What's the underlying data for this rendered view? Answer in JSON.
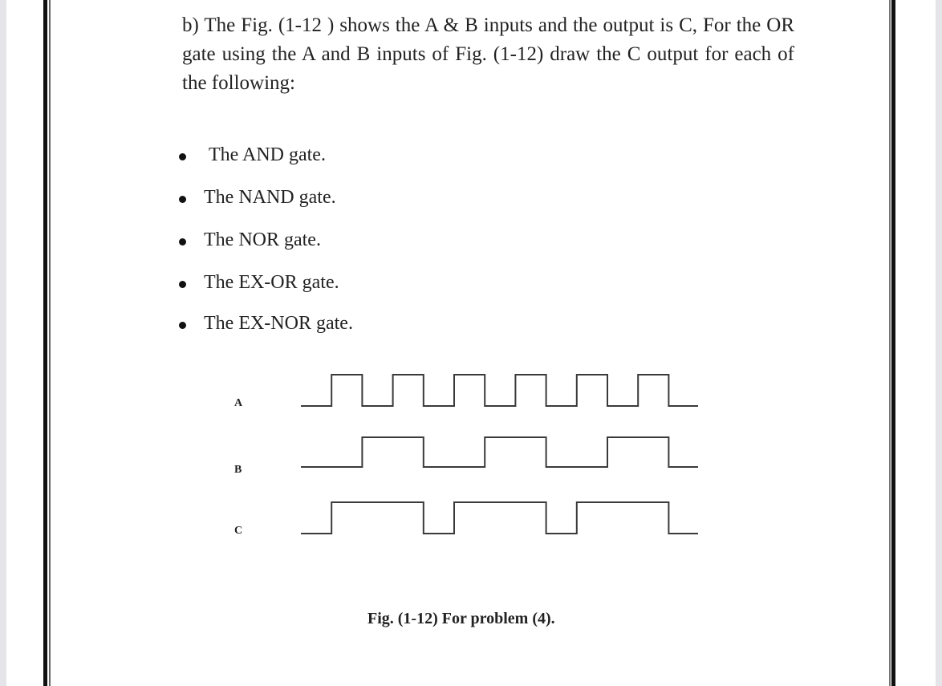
{
  "problem": {
    "text": "b) The Fig. (1-12 ) shows the A & B inputs and the output is C, For the OR gate using the A and B inputs of Fig. (1-12) draw the C output for each of the following:",
    "items": [
      "The AND gate.",
      "The NAND gate.",
      "The NOR gate.",
      "The EX-OR gate.",
      "The EX-NOR gate."
    ]
  },
  "figure": {
    "caption": "Fig. (1-12) For problem (4).",
    "signals": [
      {
        "name": "A",
        "levels": [
          0,
          1,
          0,
          1,
          0,
          1,
          0,
          1,
          0,
          1,
          0,
          1,
          0
        ]
      },
      {
        "name": "B",
        "levels": [
          0,
          0,
          1,
          1,
          0,
          0,
          1,
          1,
          0,
          0,
          1,
          1,
          0
        ]
      },
      {
        "name": "C",
        "levels": [
          0,
          1,
          1,
          1,
          0,
          1,
          1,
          1,
          0,
          1,
          1,
          1,
          0
        ]
      }
    ]
  }
}
